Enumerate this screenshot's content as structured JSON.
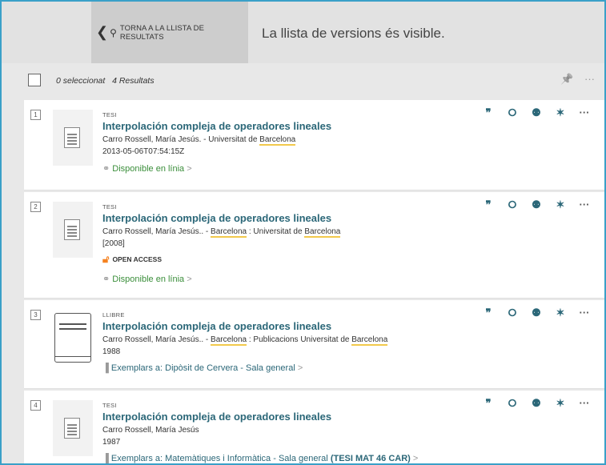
{
  "header": {
    "back_label": "TORNA A LA LLISTA DE RESULTATS",
    "message": "La llista de versions és visible."
  },
  "toolbar": {
    "selected": "0 seleccionat",
    "results": "4 Resultats"
  },
  "icons": {
    "quote": "❞",
    "link": "🔗",
    "related": "ꟿ",
    "pin": "📌",
    "more": "···",
    "back": "❮",
    "search": "⚲"
  },
  "colors": {
    "title": "#2b6778",
    "available": "#3a8e3a",
    "open_access": "#f58220",
    "frame_border": "#3aa0c8"
  },
  "results": [
    {
      "num": "1",
      "type": "TESI",
      "title": "Interpolación compleja de operadores lineales",
      "author_pre": "Carro Rossell, María Jesús. - Universitat de ",
      "author_hl": "Barcelona",
      "date": "2013-05-06T07:54:15Z",
      "availability": "Disponible en línia"
    },
    {
      "num": "2",
      "type": "TESI",
      "title": "Interpolación compleja de operadores lineales",
      "author_pre": "Carro Rossell, María Jesús.. - ",
      "author_hl1": "Barcelona",
      "author_mid": " : Universitat de ",
      "author_hl2": "Barcelona",
      "date": "[2008]",
      "open_access": "OPEN ACCESS",
      "availability": "Disponible en línia"
    },
    {
      "num": "3",
      "type": "LLIBRE",
      "title": "Interpolación compleja de operadores lineales",
      "author_pre": "Carro Rossell, María Jesús.. - ",
      "author_hl1": "Barcelona",
      "author_mid": " : Publicacions Universitat de ",
      "author_hl2": "Barcelona",
      "date": "1988",
      "holdings_label": "Exemplars a:",
      "holdings_location": "Dipòsit de Cervera",
      "holdings_sub": "- Sala general"
    },
    {
      "num": "4",
      "type": "TESI",
      "title": "Interpolación compleja de operadores lineales",
      "author": "Carro Rossell, María Jesús",
      "date": "1987",
      "holdings_label": "Exemplars a:",
      "holdings_location": "Matemàtiques i Informàtica",
      "holdings_sub": "- Sala general",
      "holdings_call": "(TESI MAT 46 CAR)"
    }
  ]
}
